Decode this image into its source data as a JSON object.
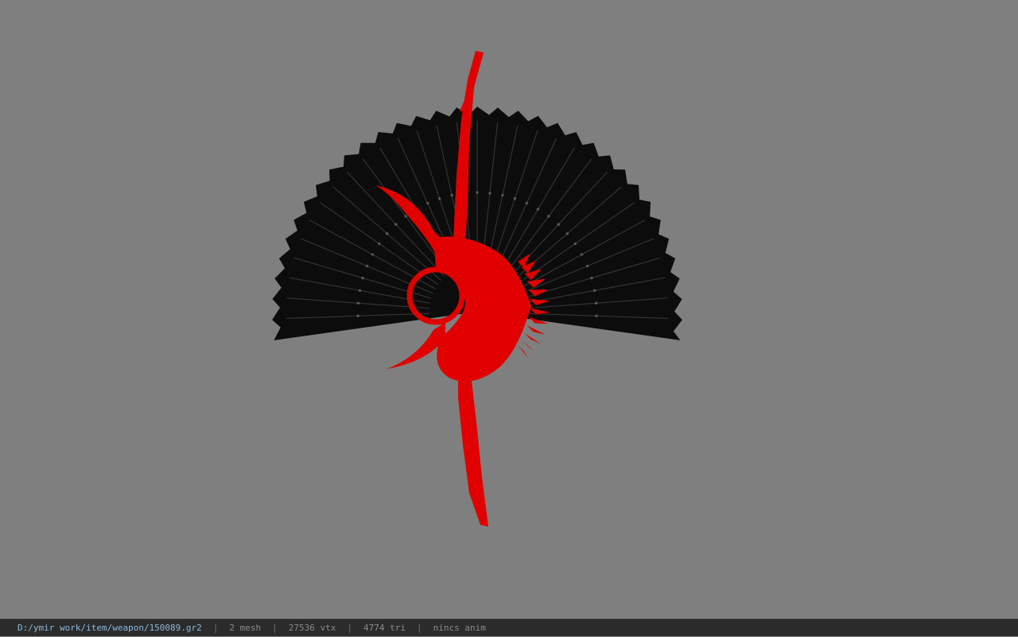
{
  "viewport": {
    "background_color": "#7f7f7f",
    "model": {
      "name": "weapon-fan-model",
      "colors": {
        "frame": "#e00000",
        "fan_leaf": "#0c0c0c",
        "fan_highlight": "#bdbdbd"
      }
    }
  },
  "statusbar": {
    "file_path": "D:/ymir work/item/weapon/150089.gr2",
    "separator": "|",
    "mesh_count": "2 mesh",
    "vertex_count": "27536 vtx",
    "triangle_count": "4774 tri",
    "anim_status": "nincs anim"
  }
}
